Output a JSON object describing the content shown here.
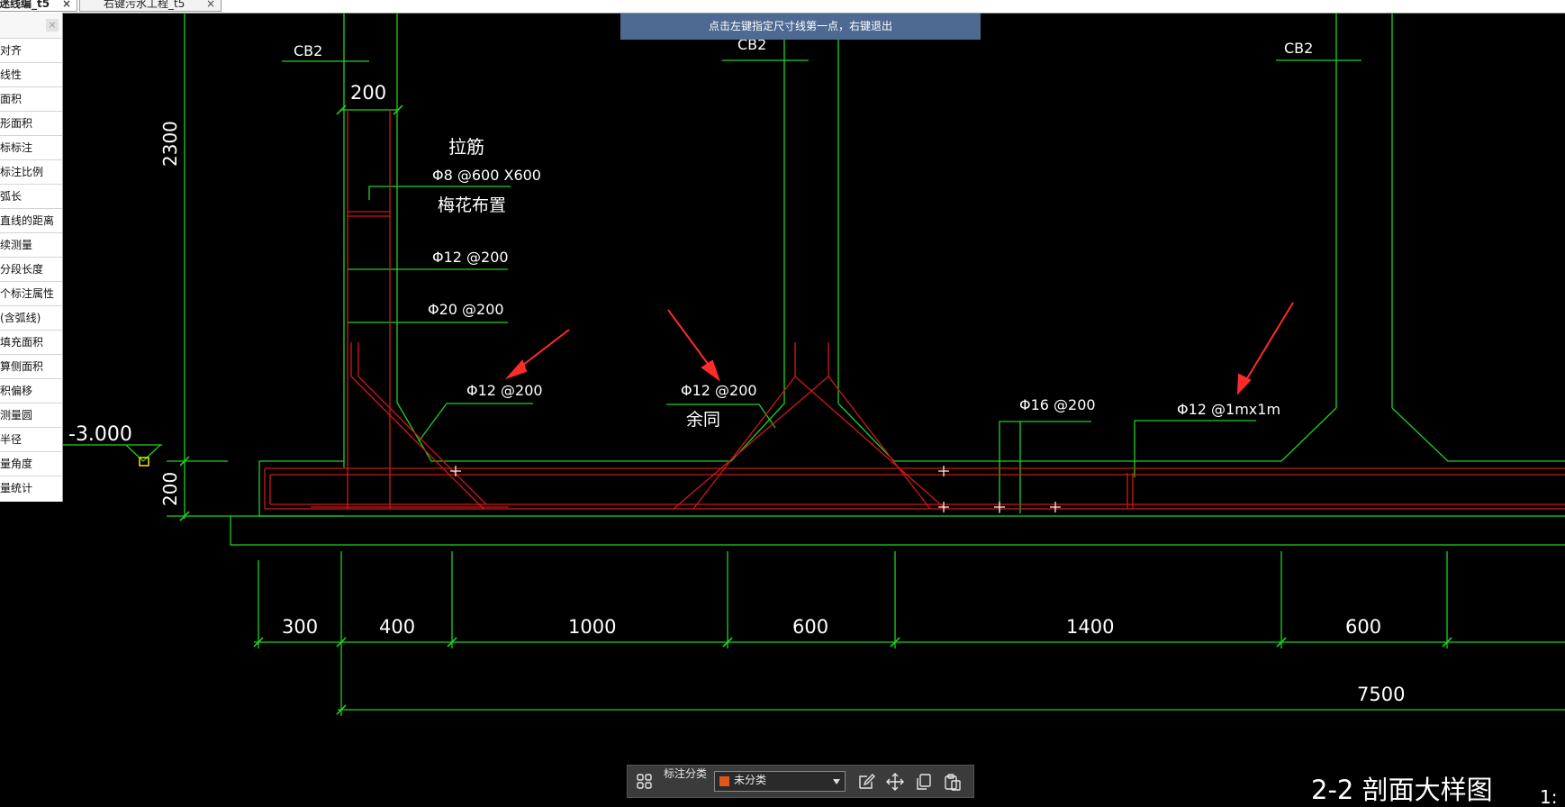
{
  "tabs": [
    {
      "label": "迷线编_t5",
      "close": "×",
      "active": true
    },
    {
      "label": "右键污水工程_t5",
      "close": "×",
      "active": false
    }
  ],
  "measure_panel": {
    "close_symbol": "×",
    "items": [
      "对齐",
      "线性",
      "面积",
      "形面积",
      "标标注",
      "标注比例",
      "弧长",
      "直线的距离",
      "续测量",
      "分段长度",
      "个标注属性",
      "(含弧线)",
      "填充面积",
      "算侧面积",
      "积偏移",
      "测量圆",
      "半径",
      "量角度",
      "量统计"
    ]
  },
  "hint_bar": {
    "text": "点击左键指定尺寸线第一点，右键退出"
  },
  "drawing": {
    "cb_labels": [
      "CB2",
      "CB2",
      "CB2"
    ],
    "elevation": "-3.000",
    "dim_200_top": "200",
    "dim_2300": "2300",
    "dim_200_left": "200",
    "tie_bar_title": "拉筋",
    "tie_bar_spec": "Φ8 @600 X600",
    "tie_bar_layout": "梅花布置",
    "rebar_1": "Φ12 @200",
    "rebar_2": "Φ20 @200",
    "rebar_3": "Φ12 @200",
    "rebar_4": "Φ12 @200",
    "rebar_4_note": "余同",
    "rebar_5": "Φ16 @200",
    "rebar_6": "Φ12 @1mx1m",
    "dims_bottom": [
      "300",
      "400",
      "1000",
      "600",
      "1400",
      "600"
    ],
    "dim_total": "7500",
    "section_title": "2-2 剖面大样图",
    "scale_fragment": "1:",
    "colors": {
      "line_green": "#1fd11f",
      "rebar_red": "#d01818",
      "arrow_red": "#ff2a2a",
      "text": "#ffffff",
      "grip_yellow": "#ffe600"
    }
  },
  "bottom_toolbar": {
    "group_icon": "layers-icon",
    "label": "标注分类",
    "select_value": "未分类",
    "swatch_color": "#e0561b",
    "actions": [
      "edit-icon",
      "move-icon",
      "copy-icon",
      "paste-icon"
    ]
  }
}
